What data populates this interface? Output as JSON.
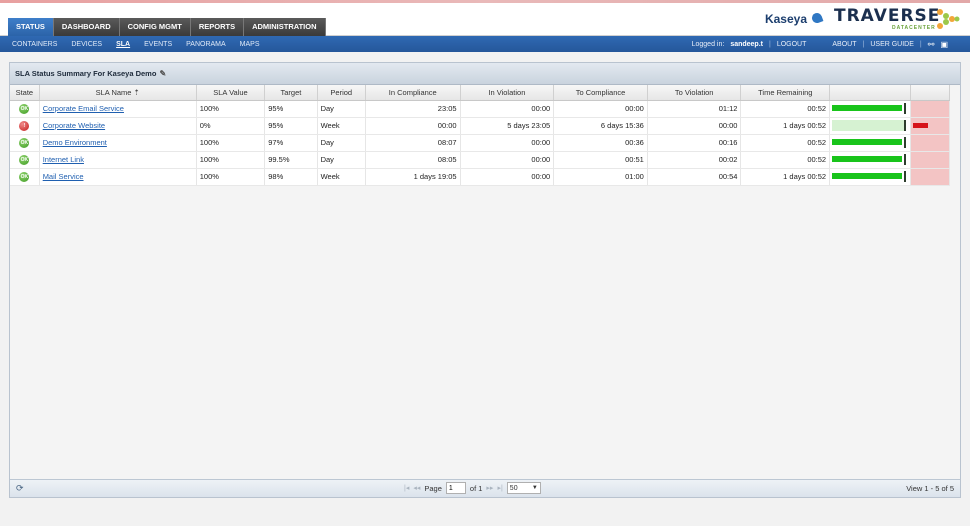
{
  "main_tabs": [
    {
      "label": "STATUS",
      "active": true
    },
    {
      "label": "DASHBOARD",
      "active": false
    },
    {
      "label": "CONFIG MGMT",
      "active": false
    },
    {
      "label": "REPORTS",
      "active": false
    },
    {
      "label": "ADMINISTRATION",
      "active": false
    }
  ],
  "brand": {
    "kaseya": "Kaseya",
    "traverse": "TRAVERSE",
    "traverse_sub": "DATACENTER"
  },
  "subnav": {
    "items": [
      {
        "label": "CONTAINERS",
        "active": false
      },
      {
        "label": "DEVICES",
        "active": false
      },
      {
        "label": "SLA",
        "active": true
      },
      {
        "label": "EVENTS",
        "active": false
      },
      {
        "label": "PANORAMA",
        "active": false
      },
      {
        "label": "MAPS",
        "active": false
      }
    ],
    "logged_in_label": "Logged in:",
    "user": "sandeep.t",
    "logout": "LOGOUT",
    "about": "ABOUT",
    "user_guide": "USER GUIDE"
  },
  "panel": {
    "title": "SLA Status Summary For Kaseya Demo"
  },
  "table": {
    "headers": [
      "State",
      "SLA Name",
      "SLA Value",
      "Target",
      "Period",
      "In Compliance",
      "In Violation",
      "To Compliance",
      "To Violation",
      "Time Remaining",
      "",
      ""
    ],
    "rows": [
      {
        "state": "ok",
        "name": "Corporate Email Service",
        "sla_value": "100%",
        "target": "95%",
        "period": "Day",
        "in_compliance": "23:05",
        "in_violation": "00:00",
        "to_compliance": "00:00",
        "to_violation": "01:12",
        "time_remaining": "00:52",
        "compliance_fill": 0.97,
        "violation_fill": 0
      },
      {
        "state": "bad",
        "name": "Corporate Website",
        "sla_value": "0%",
        "target": "95%",
        "period": "Week",
        "in_compliance": "00:00",
        "in_violation": "5 days 23:05",
        "to_compliance": "6 days 15:36",
        "to_violation": "00:00",
        "time_remaining": "1 days 00:52",
        "compliance_fill": 0,
        "violation_fill": 0.42
      },
      {
        "state": "ok",
        "name": "Demo Environment",
        "sla_value": "100%",
        "target": "97%",
        "period": "Day",
        "in_compliance": "08:07",
        "in_violation": "00:00",
        "to_compliance": "00:36",
        "to_violation": "00:16",
        "time_remaining": "00:52",
        "compliance_fill": 0.97,
        "violation_fill": 0
      },
      {
        "state": "ok",
        "name": "Internet Link",
        "sla_value": "100%",
        "target": "99.5%",
        "period": "Day",
        "in_compliance": "08:05",
        "in_violation": "00:00",
        "to_compliance": "00:51",
        "to_violation": "00:02",
        "time_remaining": "00:52",
        "compliance_fill": 0.97,
        "violation_fill": 0
      },
      {
        "state": "ok",
        "name": "Mail Service",
        "sla_value": "100%",
        "target": "98%",
        "period": "Week",
        "in_compliance": "1 days 19:05",
        "in_violation": "00:00",
        "to_compliance": "01:00",
        "to_violation": "00:54",
        "time_remaining": "1 days 00:52",
        "compliance_fill": 0.97,
        "violation_fill": 0
      }
    ]
  },
  "pager": {
    "page_label": "Page",
    "page_value": "1",
    "of_label": "of 1",
    "page_size": "50",
    "view_count": "View 1 - 5 of 5"
  },
  "colors": {
    "accent": "#2b63a8",
    "ok": "#3e9b23",
    "bad": "#c41d1d",
    "compliance_bar": "#19c41b",
    "violation_bar": "#d6131a"
  }
}
